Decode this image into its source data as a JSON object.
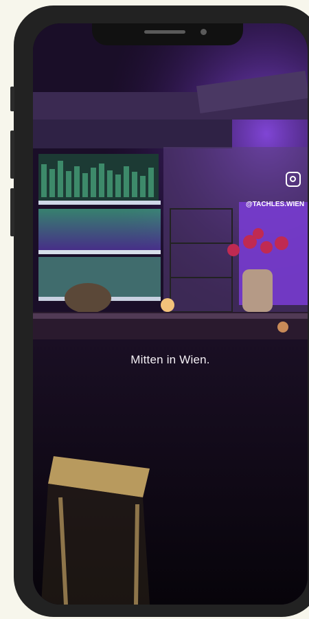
{
  "caption": "Mitten in Wien.",
  "instagram": {
    "icon": "instagram-icon",
    "handle": "@TACHLES.WIEN"
  },
  "colors": {
    "page_background": "#f7f6ec",
    "phone_frame": "#222222",
    "ambient_purple": "#7a3cd6",
    "caption_text": "#f4f0f5"
  }
}
